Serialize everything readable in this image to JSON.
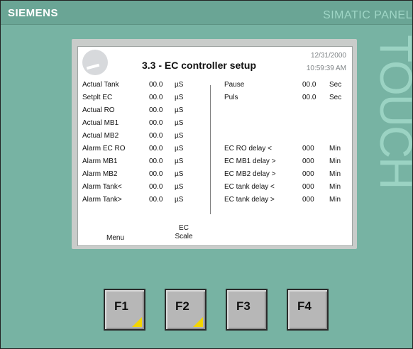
{
  "panel": {
    "brand": "SIEMENS",
    "model": "SIMATIC PANEL",
    "touch": "TOUCH"
  },
  "screen": {
    "title": "3.3 - EC controller setup",
    "date": "12/31/2000",
    "time": "10:59:39 AM",
    "rows": [
      {
        "label": "Actual Tank",
        "value": "00.0",
        "unit": "µS",
        "right_label": "Pause",
        "right_value": "00.0",
        "right_unit": "Sec"
      },
      {
        "label": "Setplt EC",
        "value": "00.0",
        "unit": "µS",
        "right_label": "Puls",
        "right_value": "00.0",
        "right_unit": "Sec"
      },
      {
        "label": "Actual RO",
        "value": "00.0",
        "unit": "µS",
        "right_label": "",
        "right_value": "",
        "right_unit": ""
      },
      {
        "label": "Actual MB1",
        "value": "00.0",
        "unit": "µS",
        "right_label": "",
        "right_value": "",
        "right_unit": ""
      },
      {
        "label": "Actual MB2",
        "value": "00.0",
        "unit": "µS",
        "right_label": "",
        "right_value": "",
        "right_unit": ""
      },
      {
        "label": "Alarm EC RO",
        "value": "00.0",
        "unit": "µS",
        "right_label": "EC RO delay <",
        "right_value": "000",
        "right_unit": "Min"
      },
      {
        "label": "Alarm MB1",
        "value": "00.0",
        "unit": "µS",
        "right_label": "EC MB1 delay >",
        "right_value": "000",
        "right_unit": "Min"
      },
      {
        "label": "Alarm MB2",
        "value": "00.0",
        "unit": "µS",
        "right_label": "EC MB2 delay >",
        "right_value": "000",
        "right_unit": "Min"
      },
      {
        "label": "Alarm Tank<",
        "value": "00.0",
        "unit": "µS",
        "right_label": "EC tank delay <",
        "right_value": "000",
        "right_unit": "Min"
      },
      {
        "label": "Alarm Tank>",
        "value": "00.0",
        "unit": "µS",
        "right_label": "EC tank delay >",
        "right_value": "000",
        "right_unit": "Min"
      }
    ],
    "softkeys": {
      "menu": "Menu",
      "ec_scale_line1": "EC",
      "ec_scale_line2": "Scale"
    }
  },
  "function_keys": [
    "F1",
    "F2",
    "F3",
    "F4"
  ],
  "colors": {
    "housing": "#77b3a3",
    "key_marker": "#f2d500"
  }
}
